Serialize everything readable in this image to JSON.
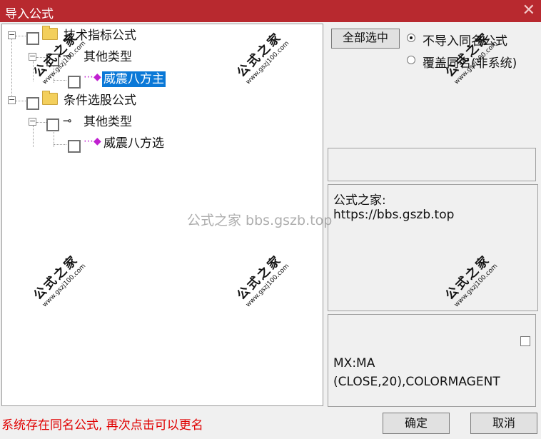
{
  "window": {
    "title": "导入公式",
    "close_glyph": "✕"
  },
  "tree": {
    "items": [
      {
        "label": "技术指标公式",
        "type": "folder"
      },
      {
        "label": "其他类型",
        "type": "category"
      },
      {
        "label": "威震八方主",
        "type": "formula",
        "selected": true
      },
      {
        "label": "条件选股公式",
        "type": "folder"
      },
      {
        "label": "其他类型",
        "type": "category"
      },
      {
        "label": "威震八方选",
        "type": "formula"
      }
    ]
  },
  "right": {
    "select_all_label": "全部选中",
    "radio_skip_label": "不导入同名公式",
    "radio_overwrite_label": "覆盖同名(非系统)",
    "info_title": "公式之家:",
    "info_url": "https://bbs.gszb.top",
    "formula_line1": "MX:MA",
    "formula_line2": "(CLOSE,20),COLORMAGENT"
  },
  "status": {
    "message": "系统存在同名公式, 再次点击可以更名"
  },
  "buttons": {
    "ok": "确定",
    "cancel": "取消"
  },
  "watermark": {
    "center_text": "公式之家 bbs.gszb.top"
  },
  "stamps": {
    "big": "公式之家",
    "small": "www.gszj100.com"
  },
  "colors": {
    "titlebar": "#b8292f",
    "selection": "#0a78d7",
    "status_text": "#e00000"
  }
}
